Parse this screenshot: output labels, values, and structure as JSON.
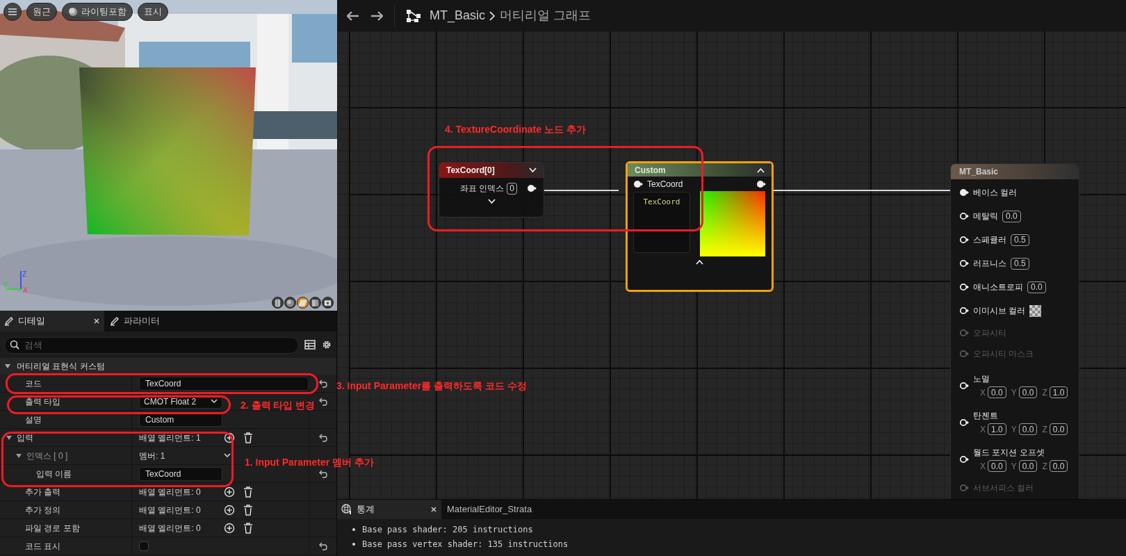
{
  "viewport": {
    "toolbar": [
      {
        "kind": "menu"
      },
      {
        "kind": "label",
        "label": "원근"
      },
      {
        "kind": "lit",
        "label": "라이팅포함"
      },
      {
        "kind": "label",
        "label": "표시"
      }
    ],
    "axes": [
      "Z",
      "Y",
      "X"
    ],
    "preview_shapes": [
      {
        "kind": "cylinder",
        "selected": false
      },
      {
        "kind": "sphere",
        "selected": false
      },
      {
        "kind": "plane",
        "selected": true
      },
      {
        "kind": "cube",
        "selected": false
      },
      {
        "kind": "mesh",
        "selected": false
      }
    ]
  },
  "details": {
    "tabs": [
      {
        "label": "디테일",
        "selected": true,
        "closable": true
      },
      {
        "label": "파라미터",
        "selected": false,
        "closable": false
      }
    ],
    "search": {
      "placeholder": "검색"
    },
    "section": {
      "title": "머티리얼 표현식 커스텀",
      "expanded": true
    },
    "rows": [
      {
        "label": "코드",
        "kind": "text",
        "value": "TexCoord",
        "reset": true
      },
      {
        "label": "출력 타입",
        "kind": "dropdown",
        "value": "CMOT Float 2",
        "reset": true
      },
      {
        "label": "설명",
        "kind": "text",
        "value": "Custom",
        "reset": false
      },
      {
        "label": "입력",
        "kind": "array",
        "value": "배열 엘리먼트: 1",
        "expanded": true,
        "reset": true,
        "children": [
          {
            "label": "인덱스 [ 0 ]",
            "kind": "member",
            "value": "멤버: 1",
            "expanded": true,
            "reset": false,
            "children": [
              {
                "label": "입력 이름",
                "kind": "text",
                "value": "TexCoord",
                "reset": true
              }
            ]
          }
        ]
      },
      {
        "label": "추가 출력",
        "kind": "array",
        "value": "배열 엘리먼트: 0",
        "reset": false
      },
      {
        "label": "추가 정의",
        "kind": "array",
        "value": "배열 엘리먼트: 0",
        "reset": false
      },
      {
        "label": "파일 경로 포함",
        "kind": "array",
        "value": "배열 엘리먼트: 0",
        "reset": false
      },
      {
        "label": "코드 표시",
        "kind": "checkbox",
        "checked": false,
        "reset": true
      }
    ]
  },
  "annotations": [
    {
      "text": "3. Input Parameter를 출력하도록 코드 수정"
    },
    {
      "text": "2. 출력 타입 변경"
    },
    {
      "text": "1. Input Parameter 멤버 추가"
    },
    {
      "text": "4. TextureCoordinate 노드 추가"
    }
  ],
  "graph": {
    "breadcrumb": [
      "MT_Basic",
      "머티리얼 그래프"
    ],
    "texcoord_node": {
      "title": "TexCoord[0]",
      "pin_label": "좌표 인덱스",
      "pin_value": "0"
    },
    "custom_node": {
      "title": "Custom",
      "input": "TexCoord",
      "code": "TexCoord"
    },
    "material_node": {
      "title": "MT_Basic",
      "inputs": [
        {
          "label": "베이스 컬러",
          "kind": "none",
          "connected": true,
          "disabled": false
        },
        {
          "label": "메탈릭",
          "kind": "scalar",
          "value": "0.0",
          "connected": false,
          "disabled": false
        },
        {
          "label": "스페큘러",
          "kind": "scalar",
          "value": "0.5",
          "connected": false,
          "disabled": false
        },
        {
          "label": "러프니스",
          "kind": "scalar",
          "value": "0.5",
          "connected": false,
          "disabled": false
        },
        {
          "label": "애니소트로피",
          "kind": "scalar",
          "value": "0.0",
          "connected": false,
          "disabled": false
        },
        {
          "label": "이미시브 컬러",
          "kind": "color",
          "connected": false,
          "disabled": false
        },
        {
          "label": "오파시티",
          "kind": "none",
          "connected": false,
          "disabled": true
        },
        {
          "label": "오파시티 마스크",
          "kind": "none",
          "connected": false,
          "disabled": true
        },
        {
          "label": "노멀",
          "kind": "vector",
          "values": [
            {
              "axis": "X",
              "value": "0.0"
            },
            {
              "axis": "Y",
              "value": "0.0"
            },
            {
              "axis": "Z",
              "value": "1.0"
            }
          ],
          "connected": false,
          "disabled": false
        },
        {
          "label": "탄젠트",
          "kind": "vector",
          "values": [
            {
              "axis": "X",
              "value": "1.0"
            },
            {
              "axis": "Y",
              "value": "0.0"
            },
            {
              "axis": "Z",
              "value": "0.0"
            }
          ],
          "connected": false,
          "disabled": false
        },
        {
          "label": "월드 포지션 오프셋",
          "kind": "vector",
          "values": [
            {
              "axis": "X",
              "value": "0.0"
            },
            {
              "axis": "Y",
              "value": "0.0"
            },
            {
              "axis": "Z",
              "value": "0.0"
            }
          ],
          "connected": false,
          "disabled": false
        },
        {
          "label": "서브서피스 컬러",
          "kind": "none",
          "connected": false,
          "disabled": true
        }
      ]
    }
  },
  "stats": {
    "tabs": [
      {
        "label": "통계",
        "selected": true,
        "closable": true
      },
      {
        "label": "MaterialEditor_Strata",
        "selected": false,
        "closable": false
      }
    ],
    "lines": [
      "Base pass shader: 205 instructions",
      "Base pass vertex shader: 135 instructions"
    ]
  }
}
